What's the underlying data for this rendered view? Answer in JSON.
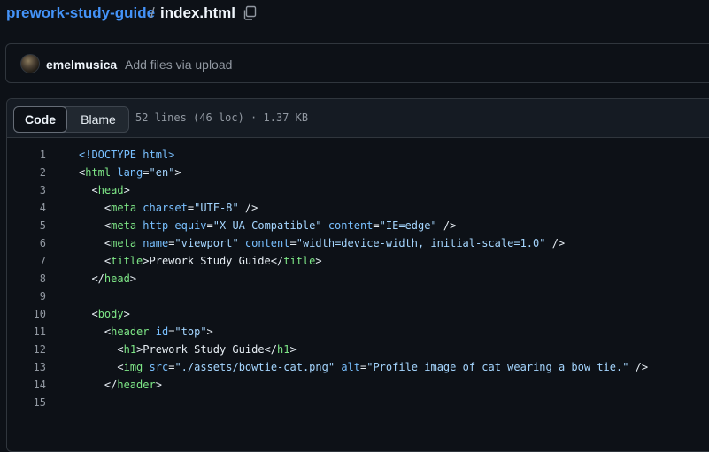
{
  "breadcrumb": {
    "repo": "prework-study-guide",
    "separator": "/",
    "file": "index.html"
  },
  "icons": {
    "copy": "copy-icon",
    "avatar": "user-avatar"
  },
  "commit": {
    "author": "emelmusica",
    "message": "Add files via upload"
  },
  "viewer": {
    "tabs": [
      {
        "label": "Code",
        "selected": true
      },
      {
        "label": "Blame",
        "selected": false
      }
    ],
    "file_meta": "52 lines (46 loc) · 1.37 KB"
  },
  "colors": {
    "background": "#0d1117",
    "link": "#4493f8",
    "tag": "#7ee787",
    "attribute": "#79c0ff",
    "string": "#a5d6ff",
    "muted": "#9198a1"
  },
  "code_lines": [
    {
      "n": "1",
      "indent": 0,
      "tokens": [
        [
          "attr",
          "<!DOCTYPE html>"
        ]
      ]
    },
    {
      "n": "2",
      "indent": 0,
      "tokens": [
        [
          "text",
          "<"
        ],
        [
          "tag",
          "html"
        ],
        [
          "text",
          " "
        ],
        [
          "attr",
          "lang"
        ],
        [
          "text",
          "="
        ],
        [
          "str",
          "\"en\""
        ],
        [
          "text",
          ">"
        ]
      ]
    },
    {
      "n": "3",
      "indent": 2,
      "tokens": [
        [
          "text",
          "<"
        ],
        [
          "tag",
          "head"
        ],
        [
          "text",
          ">"
        ]
      ]
    },
    {
      "n": "4",
      "indent": 4,
      "tokens": [
        [
          "text",
          "<"
        ],
        [
          "tag",
          "meta"
        ],
        [
          "text",
          " "
        ],
        [
          "attr",
          "charset"
        ],
        [
          "text",
          "="
        ],
        [
          "str",
          "\"UTF-8\""
        ],
        [
          "text",
          " />"
        ]
      ]
    },
    {
      "n": "5",
      "indent": 4,
      "tokens": [
        [
          "text",
          "<"
        ],
        [
          "tag",
          "meta"
        ],
        [
          "text",
          " "
        ],
        [
          "attr",
          "http-equiv"
        ],
        [
          "text",
          "="
        ],
        [
          "str",
          "\"X-UA-Compatible\""
        ],
        [
          "text",
          " "
        ],
        [
          "attr",
          "content"
        ],
        [
          "text",
          "="
        ],
        [
          "str",
          "\"IE=edge\""
        ],
        [
          "text",
          " />"
        ]
      ]
    },
    {
      "n": "6",
      "indent": 4,
      "tokens": [
        [
          "text",
          "<"
        ],
        [
          "tag",
          "meta"
        ],
        [
          "text",
          " "
        ],
        [
          "attr",
          "name"
        ],
        [
          "text",
          "="
        ],
        [
          "str",
          "\"viewport\""
        ],
        [
          "text",
          " "
        ],
        [
          "attr",
          "content"
        ],
        [
          "text",
          "="
        ],
        [
          "str",
          "\"width=device-width, initial-scale=1.0\""
        ],
        [
          "text",
          " />"
        ]
      ]
    },
    {
      "n": "7",
      "indent": 4,
      "tokens": [
        [
          "text",
          "<"
        ],
        [
          "tag",
          "title"
        ],
        [
          "text",
          ">Prework Study Guide</"
        ],
        [
          "tag",
          "title"
        ],
        [
          "text",
          ">"
        ]
      ]
    },
    {
      "n": "8",
      "indent": 2,
      "tokens": [
        [
          "text",
          "</"
        ],
        [
          "tag",
          "head"
        ],
        [
          "text",
          ">"
        ]
      ]
    },
    {
      "n": "9",
      "indent": 0,
      "tokens": []
    },
    {
      "n": "10",
      "indent": 2,
      "tokens": [
        [
          "text",
          "<"
        ],
        [
          "tag",
          "body"
        ],
        [
          "text",
          ">"
        ]
      ]
    },
    {
      "n": "11",
      "indent": 4,
      "tokens": [
        [
          "text",
          "<"
        ],
        [
          "tag",
          "header"
        ],
        [
          "text",
          " "
        ],
        [
          "attr",
          "id"
        ],
        [
          "text",
          "="
        ],
        [
          "str",
          "\"top\""
        ],
        [
          "text",
          ">"
        ]
      ]
    },
    {
      "n": "12",
      "indent": 6,
      "tokens": [
        [
          "text",
          "<"
        ],
        [
          "tag",
          "h1"
        ],
        [
          "text",
          ">Prework Study Guide</"
        ],
        [
          "tag",
          "h1"
        ],
        [
          "text",
          ">"
        ]
      ]
    },
    {
      "n": "13",
      "indent": 6,
      "tokens": [
        [
          "text",
          "<"
        ],
        [
          "tag",
          "img"
        ],
        [
          "text",
          " "
        ],
        [
          "attr",
          "src"
        ],
        [
          "text",
          "="
        ],
        [
          "str",
          "\"./assets/bowtie-cat.png\""
        ],
        [
          "text",
          " "
        ],
        [
          "attr",
          "alt"
        ],
        [
          "text",
          "="
        ],
        [
          "str",
          "\"Profile image of cat wearing a bow tie.\""
        ],
        [
          "text",
          " />"
        ]
      ]
    },
    {
      "n": "14",
      "indent": 4,
      "tokens": [
        [
          "text",
          "</"
        ],
        [
          "tag",
          "header"
        ],
        [
          "text",
          ">"
        ]
      ]
    },
    {
      "n": "15",
      "indent": 0,
      "tokens": []
    }
  ]
}
